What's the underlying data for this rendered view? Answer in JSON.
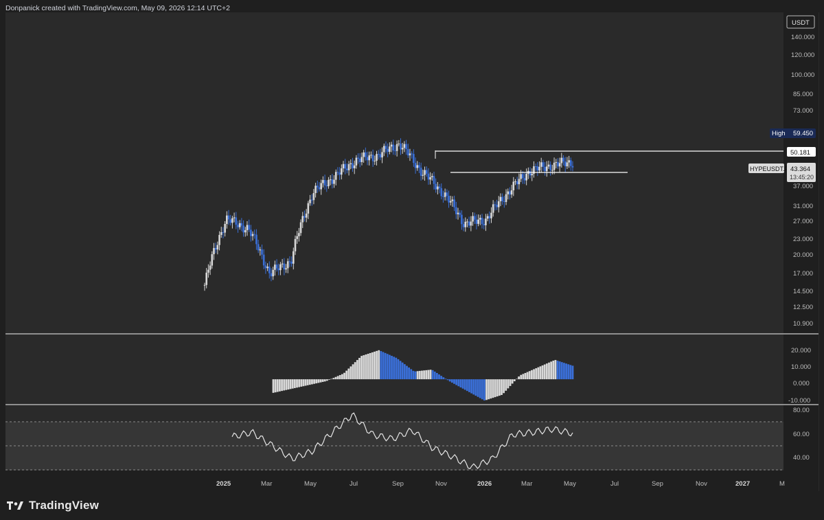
{
  "header": {
    "credit": "Donpanick created with TradingView.com, May 09, 2026 12:14 UTC+2"
  },
  "footer": {
    "brand": "TradingView"
  },
  "price_scale": {
    "currency": "USDT",
    "ticks": [
      "140.000",
      "120.000",
      "100.000",
      "85.000",
      "73.000",
      "59.450",
      "50.181",
      "43.364",
      "37.000",
      "31.000",
      "27.000",
      "23.000",
      "20.000",
      "17.000",
      "14.500",
      "12.500",
      "10.900"
    ]
  },
  "markers": {
    "high_label": "High",
    "high_value": "59.450",
    "level_value": "50.181",
    "symbol": "HYPEUSDT.P",
    "last_price": "43.364",
    "countdown": "13:45:20"
  },
  "macd_scale": {
    "ticks": [
      "20.000",
      "10.000",
      "0.000",
      "-10.000"
    ]
  },
  "rsi_scale": {
    "ticks": [
      "80.00",
      "60.00",
      "40.00"
    ]
  },
  "time_axis": {
    "labels": [
      "2025",
      "Mar",
      "May",
      "Jul",
      "Sep",
      "Nov",
      "2026",
      "Mar",
      "May",
      "Jul",
      "Sep",
      "Nov",
      "2027",
      "M"
    ]
  },
  "colors": {
    "background": "#1f1f1f",
    "plot": "#2a2a2a",
    "up": "#d9d9d9",
    "down": "#3a6fd8",
    "line": "#ffffff",
    "high_badge": "#1a2a55"
  },
  "chart_data": [
    {
      "type": "candlestick",
      "title": "HYPEUSDT.P",
      "scale": "log",
      "ylim": [
        9.5,
        160
      ],
      "x": [
        "2024-12",
        "2025-01",
        "2025-02",
        "2025-03",
        "2025-04",
        "2025-05",
        "2025-06",
        "2025-07",
        "2025-08",
        "2025-09",
        "2025-10",
        "2025-11",
        "2025-12",
        "2026-01",
        "2026-02",
        "2026-03",
        "2026-04",
        "2026-05"
      ],
      "close": [
        14.5,
        26.0,
        24.0,
        16.0,
        18.0,
        33.0,
        38.0,
        44.0,
        46.0,
        51.0,
        40.0,
        33.0,
        25.0,
        26.0,
        33.0,
        40.0,
        42.0,
        43.364
      ],
      "high_marker": 59.45,
      "levels": [
        50.181,
        43.364
      ]
    },
    {
      "type": "histogram",
      "title": "",
      "ylim": [
        -12,
        22
      ],
      "x": [
        "2024-12",
        "2025-01",
        "2025-02",
        "2025-03",
        "2025-04",
        "2025-05",
        "2025-06",
        "2025-07",
        "2025-08",
        "2025-09",
        "2025-10",
        "2025-11",
        "2025-12",
        "2026-01",
        "2026-02",
        "2026-03",
        "2026-04",
        "2026-05"
      ],
      "values": [
        -7,
        -5,
        -3,
        -1,
        3,
        12,
        15,
        11,
        4,
        5,
        -1,
        -6,
        -11,
        -8,
        2,
        6,
        10,
        7
      ]
    },
    {
      "type": "line",
      "title": "",
      "ylim": [
        28,
        84
      ],
      "x": [
        "2024-12",
        "2025-01",
        "2025-02",
        "2025-03",
        "2025-04",
        "2025-05",
        "2025-06",
        "2025-07",
        "2025-08",
        "2025-09",
        "2025-10",
        "2025-11",
        "2025-12",
        "2026-01",
        "2026-02",
        "2026-03",
        "2026-04",
        "2026-05"
      ],
      "values": [
        58,
        62,
        50,
        38,
        45,
        62,
        78,
        60,
        56,
        64,
        48,
        40,
        30,
        38,
        60,
        62,
        65,
        61
      ],
      "bands": [
        70,
        50,
        30
      ]
    }
  ]
}
